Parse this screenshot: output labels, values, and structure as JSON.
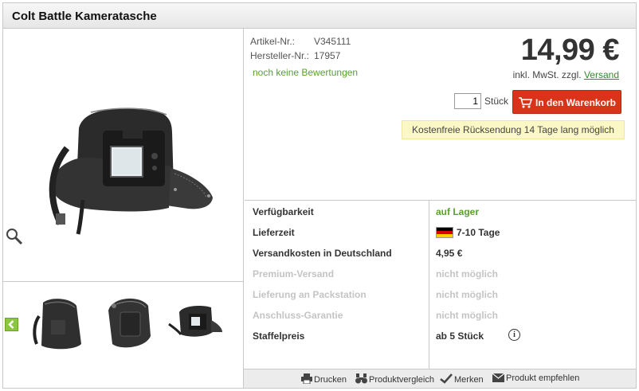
{
  "product": {
    "title": "Colt Battle Kameratasche",
    "article_label": "Artikel-Nr.:",
    "article_value": "V345111",
    "manufacturer_label": "Hersteller-Nr.:",
    "manufacturer_value": "17957",
    "rating_text": "noch keine Bewertungen"
  },
  "pricing": {
    "price": "14,99 €",
    "vat_text": "inkl. MwSt. zzgl.",
    "shipping_link": "Versand"
  },
  "cart": {
    "quantity": "1",
    "unit": "Stück",
    "button_label": "In den Warenkorb"
  },
  "notice": "Kostenfreie Rücksendung 14 Tage lang möglich",
  "info": {
    "rows": [
      {
        "label": "Verfügbarkeit",
        "value": "auf Lager"
      },
      {
        "label": "Lieferzeit",
        "value": "7-10 Tage"
      },
      {
        "label": "Versandkosten in Deutschland",
        "value": "4,95 €"
      },
      {
        "label": "Premium-Versand",
        "value": "nicht möglich"
      },
      {
        "label": "Lieferung an Packstation",
        "value": "nicht möglich"
      },
      {
        "label": "Anschluss-Garantie",
        "value": "nicht möglich"
      },
      {
        "label": "Staffelpreis",
        "value": "ab 5 Stück"
      }
    ]
  },
  "actions": {
    "print": "Drucken",
    "compare": "Produktvergleich",
    "remember": "Merken",
    "recommend": "Produkt empfehlen"
  },
  "icons": {
    "zoom": "magnifier-icon",
    "prev": "arrow-left-icon",
    "cart": "shopping-cart-icon",
    "info": "info-icon",
    "print": "printer-icon",
    "compare": "binoculars-icon",
    "remember": "checkmark-icon",
    "recommend": "envelope-icon"
  },
  "colors": {
    "accent_red": "#d9341a",
    "green": "#5aa02c",
    "notice_bg": "#fcf8c5"
  }
}
